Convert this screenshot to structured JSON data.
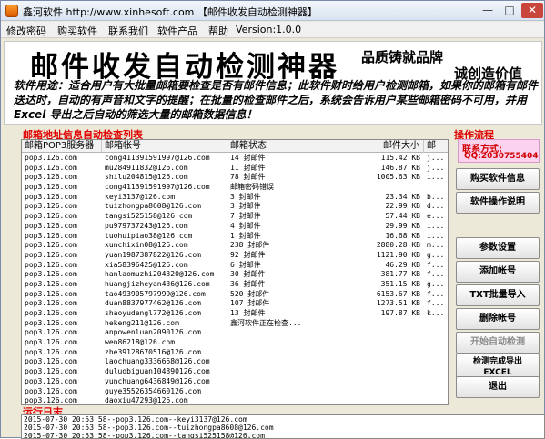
{
  "window": {
    "title": "鑫河软件 http://www.xinhesoft.com 【邮件收发自动检测神器】"
  },
  "menu": [
    "修改密码",
    "购买软件",
    "联系我们",
    "软件产品",
    "帮助",
    "Version:1.0.0"
  ],
  "banner": {
    "title": "邮件收发自动检测神器",
    "slogan1": "品质铸就品牌",
    "slogan2": "创造价值",
    "slogan2_prefix": "诚",
    "description": "软件用途：适合用户有大批量邮箱要检查是否有邮件信息；此软件财时给用户检测邮箱，如果你的邮箱有邮件送达时，自动的有声音和文字的提醒；在批量的检查邮件之后，系统会告诉用户某些邮箱密码不可用，并用 Excel 导出之后自动的筛选大量的邮箱数据信息！"
  },
  "list_section": {
    "label": "邮箱地址信息自动检查列表",
    "headers": [
      "邮箱POP3服务器",
      "邮箱帐号",
      "邮箱状态",
      "邮件大小",
      "邮"
    ],
    "rows": [
      [
        "pop3.126.com",
        "cong411391591997@126.com",
        "14 封邮件",
        "115.42 KB",
        "j..."
      ],
      [
        "pop3.126.com",
        "mu284911832@126.com",
        "11 封邮件",
        "146.87 KB",
        "j..."
      ],
      [
        "pop3.126.com",
        "shilu204815@126.com",
        "78 封邮件",
        "1005.63 KB",
        "i..."
      ],
      [
        "pop3.126.com",
        "cong411391591997@126.com",
        "邮箱密码错误",
        "",
        ""
      ],
      [
        "pop3.126.com",
        "keyi3137@126.com",
        "3 封邮件",
        "23.34 KB",
        "b..."
      ],
      [
        "pop3.126.com",
        "tuizhongpa8608@126.com",
        "3 封邮件",
        "22.99 KB",
        "d..."
      ],
      [
        "pop3.126.com",
        "tangsi525158@126.com",
        "7 封邮件",
        "57.44 KB",
        "e..."
      ],
      [
        "pop3.126.com",
        "pu979737243@126.com",
        "4 封邮件",
        "29.99 KB",
        "i..."
      ],
      [
        "pop3.126.com",
        "tuohuipiao38@126.com",
        "1 封邮件",
        "16.68 KB",
        "i..."
      ],
      [
        "pop3.126.com",
        "xunchixin08@126.com",
        "238 封邮件",
        "2880.28 KB",
        "m..."
      ],
      [
        "pop3.126.com",
        "yuan1987387822@126.com",
        "92 封邮件",
        "1121.90 KB",
        "g..."
      ],
      [
        "pop3.126.com",
        "xia58396425@126.com",
        "6 封邮件",
        "46.29 KB",
        "f..."
      ],
      [
        "pop3.126.com",
        "hanlaomuzhi204320@126.com",
        "30 封邮件",
        "381.77 KB",
        "f..."
      ],
      [
        "pop3.126.com",
        "huangjizheyan436@126.com",
        "36 封邮件",
        "351.15 KB",
        "g..."
      ],
      [
        "pop3.126.com",
        "tao493905797999@126.com",
        "520 封邮件",
        "6153.67 KB",
        "f..."
      ],
      [
        "pop3.126.com",
        "duan8837977462@126.com",
        "107 封邮件",
        "1273.51 KB",
        "f..."
      ],
      [
        "pop3.126.com",
        "shaoyudengl772@126.com",
        "13 封邮件",
        "197.87 KB",
        "k..."
      ],
      [
        "pop3.126.com",
        "hekeng211@126.com",
        "鑫河软件正在检查...",
        "",
        ""
      ],
      [
        "pop3.126.com",
        "anpowenluan2090126.com",
        "",
        "",
        ""
      ],
      [
        "pop3.126.com",
        "wen86218@126.com",
        "",
        "",
        ""
      ],
      [
        "pop3.126.com",
        "zhe39128670516@126.com",
        "",
        "",
        ""
      ],
      [
        "pop3.126.com",
        "laochuang3336668@126.com",
        "",
        "",
        ""
      ],
      [
        "pop3.126.com",
        "duluobiguan104890126.com",
        "",
        "",
        ""
      ],
      [
        "pop3.126.com",
        "yunchuang6436849@126.com",
        "",
        "",
        ""
      ],
      [
        "pop3.126.com",
        "guye35526354660126.com",
        "",
        "",
        ""
      ],
      [
        "pop3.126.com",
        "daoxiu47293@126.com",
        "",
        "",
        ""
      ]
    ]
  },
  "side": {
    "label": "操作流程",
    "contact_label": "联系方式:",
    "contact_qq": "QQ:2030755404",
    "buttons": {
      "buy_info": "购买软件信息",
      "manual": "软件操作说明",
      "params": "参数设置",
      "add_account": "添加帐号",
      "txt_import": "TXT批量导入",
      "delete_account": "删除帐号",
      "start_check": "开始自动检测",
      "export_line1": "检测完成导出",
      "export_line2": "EXCEL",
      "exit": "退出"
    }
  },
  "log": {
    "label": "运行日志",
    "lines": [
      "2015-07-30 20:53:58--pop3.126.com--keyi3137@126.com",
      "2015-07-30 20:53:58--pop3.126.com--tuizhongpa8608@126.com",
      "2015-07-30 20:53:58--pop3.126.com--tangsi525158@126.com"
    ]
  }
}
